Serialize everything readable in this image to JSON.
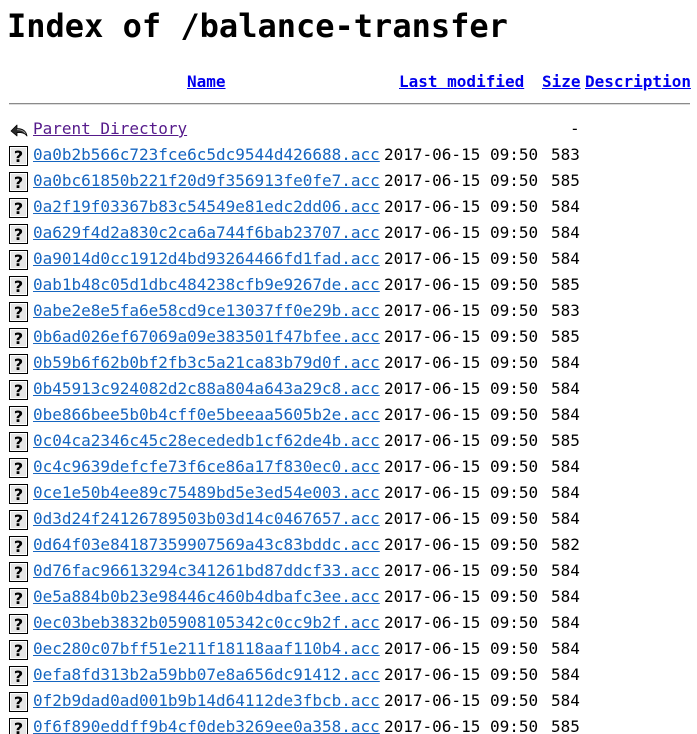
{
  "page": {
    "title": "Index of /balance-transfer"
  },
  "columns": {
    "name": "Name",
    "last_modified": "Last modified",
    "size": "Size",
    "description": "Description"
  },
  "parent": {
    "label": "Parent Directory",
    "size": "-",
    "icon": "back-arrow-icon"
  },
  "files": [
    {
      "name": "0a0b2b566c723fce6c5dc9544d426688.acc",
      "modified": "2017-06-15 09:50",
      "size": "583"
    },
    {
      "name": "0a0bc61850b221f20d9f356913fe0fe7.acc",
      "modified": "2017-06-15 09:50",
      "size": "585"
    },
    {
      "name": "0a2f19f03367b83c54549e81edc2dd06.acc",
      "modified": "2017-06-15 09:50",
      "size": "584"
    },
    {
      "name": "0a629f4d2a830c2ca6a744f6bab23707.acc",
      "modified": "2017-06-15 09:50",
      "size": "584"
    },
    {
      "name": "0a9014d0cc1912d4bd93264466fd1fad.acc",
      "modified": "2017-06-15 09:50",
      "size": "584"
    },
    {
      "name": "0ab1b48c05d1dbc484238cfb9e9267de.acc",
      "modified": "2017-06-15 09:50",
      "size": "585"
    },
    {
      "name": "0abe2e8e5fa6e58cd9ce13037ff0e29b.acc",
      "modified": "2017-06-15 09:50",
      "size": "583"
    },
    {
      "name": "0b6ad026ef67069a09e383501f47bfee.acc",
      "modified": "2017-06-15 09:50",
      "size": "585"
    },
    {
      "name": "0b59b6f62b0bf2fb3c5a21ca83b79d0f.acc",
      "modified": "2017-06-15 09:50",
      "size": "584"
    },
    {
      "name": "0b45913c924082d2c88a804a643a29c8.acc",
      "modified": "2017-06-15 09:50",
      "size": "584"
    },
    {
      "name": "0be866bee5b0b4cff0e5beeaa5605b2e.acc",
      "modified": "2017-06-15 09:50",
      "size": "584"
    },
    {
      "name": "0c04ca2346c45c28ecededb1cf62de4b.acc",
      "modified": "2017-06-15 09:50",
      "size": "585"
    },
    {
      "name": "0c4c9639defcfe73f6ce86a17f830ec0.acc",
      "modified": "2017-06-15 09:50",
      "size": "584"
    },
    {
      "name": "0ce1e50b4ee89c75489bd5e3ed54e003.acc",
      "modified": "2017-06-15 09:50",
      "size": "584"
    },
    {
      "name": "0d3d24f24126789503b03d14c0467657.acc",
      "modified": "2017-06-15 09:50",
      "size": "584"
    },
    {
      "name": "0d64f03e84187359907569a43c83bddc.acc",
      "modified": "2017-06-15 09:50",
      "size": "582"
    },
    {
      "name": "0d76fac96613294c341261bd87ddcf33.acc",
      "modified": "2017-06-15 09:50",
      "size": "584"
    },
    {
      "name": "0e5a884b0b23e98446c460b4dbafc3ee.acc",
      "modified": "2017-06-15 09:50",
      "size": "584"
    },
    {
      "name": "0ec03beb3832b05908105342c0cc9b2f.acc",
      "modified": "2017-06-15 09:50",
      "size": "584"
    },
    {
      "name": "0ec280c07bff51e211f18118aaf110b4.acc",
      "modified": "2017-06-15 09:50",
      "size": "584"
    },
    {
      "name": "0efa8fd313b2a59bb07e8a656dc91412.acc",
      "modified": "2017-06-15 09:50",
      "size": "584"
    },
    {
      "name": "0f2b9dad0ad001b9b14d64112de3fbcb.acc",
      "modified": "2017-06-15 09:50",
      "size": "584"
    },
    {
      "name": "0f6f890eddff9b4cf0deb3269ee0a358.acc",
      "modified": "2017-06-15 09:50",
      "size": "585"
    }
  ],
  "file_icon": "unknown-file-icon",
  "colors": {
    "link": "#1565c0",
    "visited_link": "#551a8b",
    "header_link": "#0000ee"
  }
}
